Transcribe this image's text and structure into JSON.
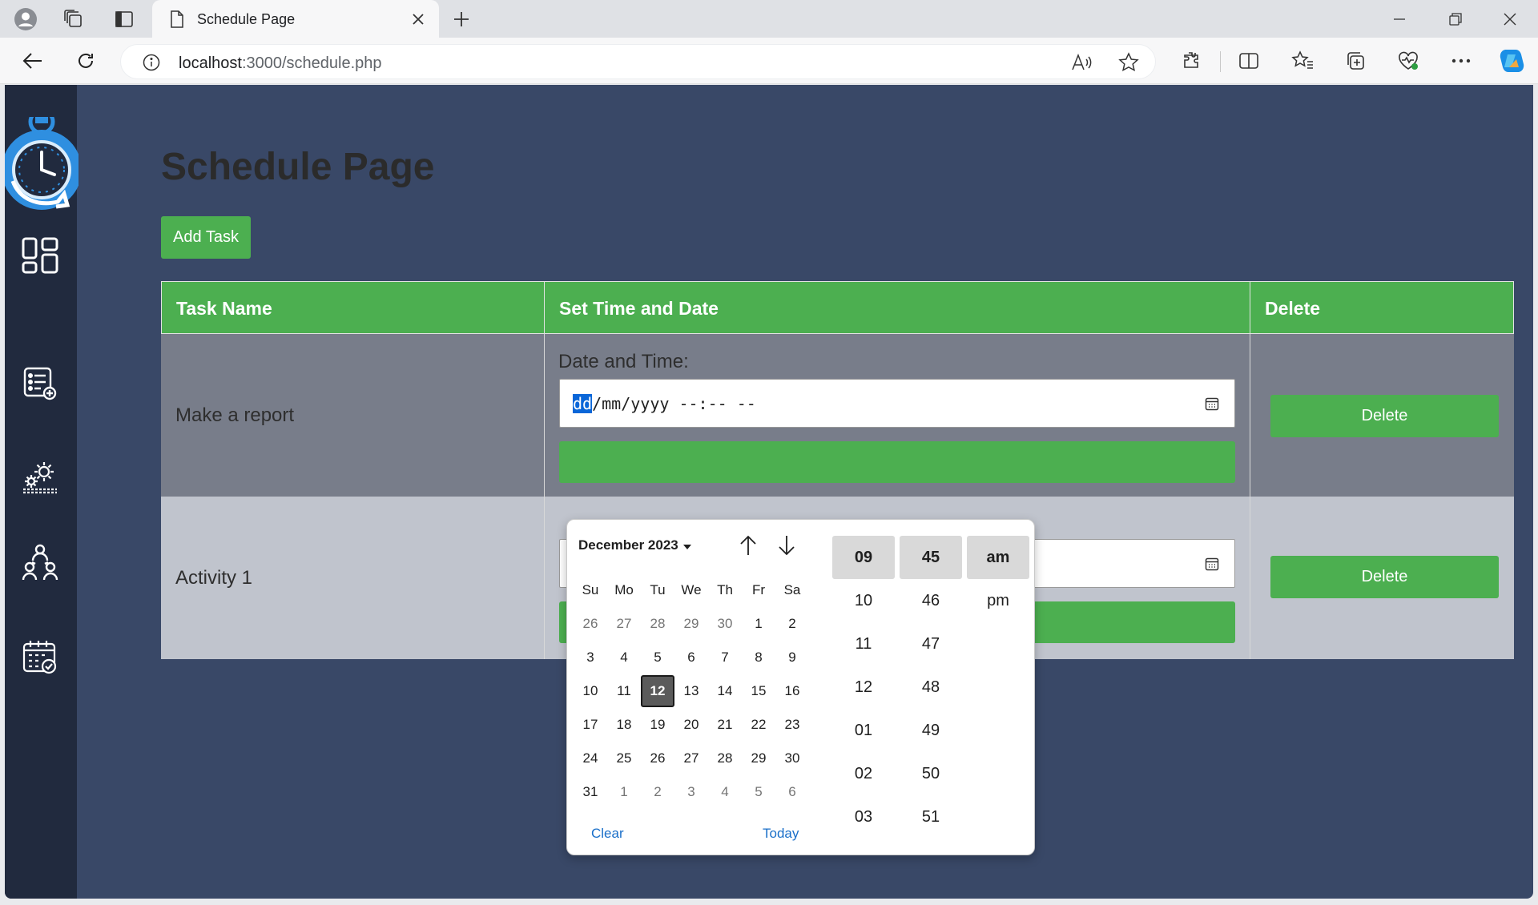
{
  "browser": {
    "tab_title": "Schedule Page",
    "url_host": "localhost",
    "url_path": ":3000/schedule.php"
  },
  "page": {
    "title": "Schedule Page",
    "add_task_label": "Add Task"
  },
  "table": {
    "headers": [
      "Task Name",
      "Set Time and Date",
      "Delete"
    ],
    "rows": [
      {
        "task": "Make a report",
        "datetime_label": "Date and Time:",
        "datetime_segments": [
          "dd",
          "/mm/yyyy --:-- --"
        ],
        "delete_label": "Delete"
      },
      {
        "task": "Activity 1",
        "delete_label": "Delete"
      }
    ]
  },
  "picker": {
    "month_label": "December 2023",
    "weekdays": [
      "Su",
      "Mo",
      "Tu",
      "We",
      "Th",
      "Fr",
      "Sa"
    ],
    "weeks": [
      [
        "26",
        "27",
        "28",
        "29",
        "30",
        "1",
        "2"
      ],
      [
        "3",
        "4",
        "5",
        "6",
        "7",
        "8",
        "9"
      ],
      [
        "10",
        "11",
        "12",
        "13",
        "14",
        "15",
        "16"
      ],
      [
        "17",
        "18",
        "19",
        "20",
        "21",
        "22",
        "23"
      ],
      [
        "24",
        "25",
        "26",
        "27",
        "28",
        "29",
        "30"
      ],
      [
        "31",
        "1",
        "2",
        "3",
        "4",
        "5",
        "6"
      ]
    ],
    "selected_day": "12",
    "clear_label": "Clear",
    "today_label": "Today",
    "hours": [
      "09",
      "10",
      "11",
      "12",
      "01",
      "02",
      "03"
    ],
    "minutes": [
      "45",
      "46",
      "47",
      "48",
      "49",
      "50",
      "51"
    ],
    "periods": [
      "am",
      "pm"
    ],
    "selected_hour": "09",
    "selected_minute": "45",
    "selected_period": "am"
  },
  "sidebar": {
    "icons": [
      "dashboard-icon",
      "task-list-icon",
      "settings-gears-icon",
      "team-icon",
      "calendar-check-icon"
    ]
  },
  "colors": {
    "accent_green": "#4caf50",
    "page_bg": "#394867",
    "sidebar_bg": "#212a3e"
  }
}
